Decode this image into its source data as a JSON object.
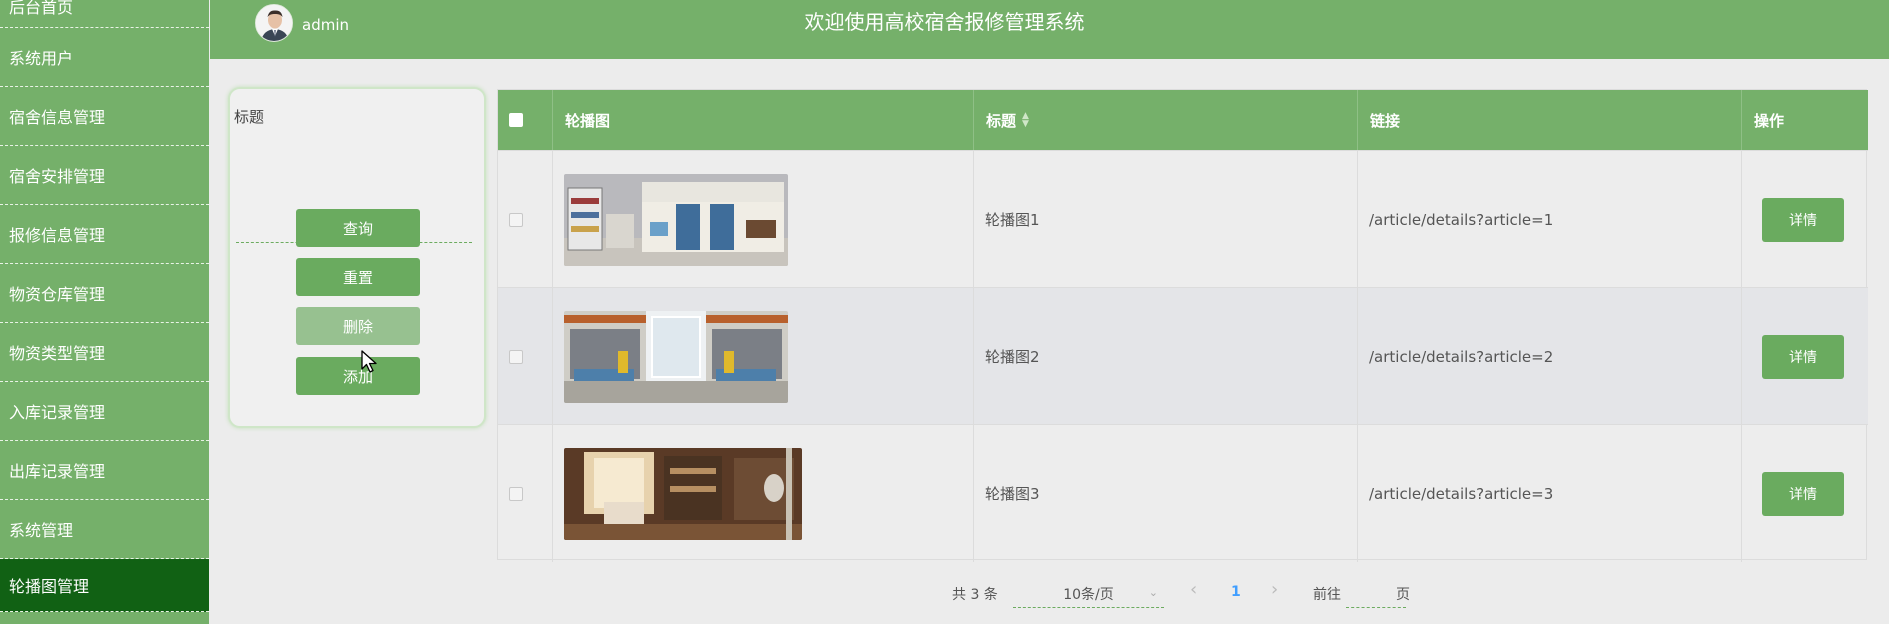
{
  "sidebar": {
    "items": [
      {
        "label": "后台首页"
      },
      {
        "label": "系统用户"
      },
      {
        "label": "宿舍信息管理"
      },
      {
        "label": "宿舍安排管理"
      },
      {
        "label": "报修信息管理"
      },
      {
        "label": "物资仓库管理"
      },
      {
        "label": "物资类型管理"
      },
      {
        "label": "入库记录管理"
      },
      {
        "label": "出库记录管理"
      },
      {
        "label": "系统管理"
      },
      {
        "label": "轮播图管理",
        "active": true
      }
    ]
  },
  "header": {
    "username": "admin",
    "title": "欢迎使用高校宿舍报修管理系统"
  },
  "search": {
    "title_label": "标题",
    "title_value": "",
    "query_label": "查询",
    "reset_label": "重置",
    "delete_label": "删除",
    "add_label": "添加"
  },
  "table": {
    "headers": {
      "image": "轮播图",
      "title": "标题",
      "link": "链接",
      "action": "操作"
    },
    "rows": [
      {
        "title": "轮播图1",
        "link": "/article/details?article=1",
        "action": "详情"
      },
      {
        "title": "轮播图2",
        "link": "/article/details?article=2",
        "action": "详情"
      },
      {
        "title": "轮播图3",
        "link": "/article/details?article=3",
        "action": "详情"
      }
    ]
  },
  "pagination": {
    "total": "共 3 条",
    "page_size": "10条/页",
    "prev": "‹",
    "current": "1",
    "next": "›",
    "goto_prefix": "前往",
    "goto_suffix": "页"
  },
  "colors": {
    "primary": "#75b06a",
    "active_nav": "#116114",
    "button": "#6aab5f"
  }
}
